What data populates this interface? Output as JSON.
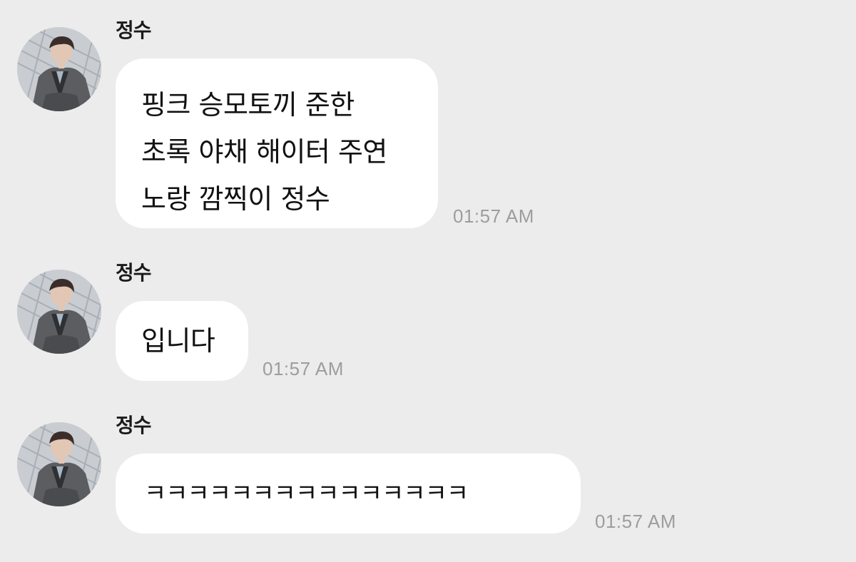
{
  "messages": [
    {
      "sender": "정수",
      "lines": [
        "핑크 승모토끼 준한",
        "초록 야채 해이터 주연",
        "노랑 깜찍이 정수"
      ],
      "time": "01:57 AM"
    },
    {
      "sender": "정수",
      "lines": [
        "입니다"
      ],
      "time": "01:57 AM"
    },
    {
      "sender": "정수",
      "lines": [
        "ㅋㅋㅋㅋㅋㅋㅋㅋㅋㅋㅋㅋㅋㅋㅋ"
      ],
      "time": "01:57 AM"
    }
  ],
  "colors": {
    "background": "#ececec",
    "bubble": "#ffffff",
    "timestamp": "#9d9d9d",
    "text": "#111111"
  },
  "icons": {
    "avatar": "profile-photo-icon"
  }
}
